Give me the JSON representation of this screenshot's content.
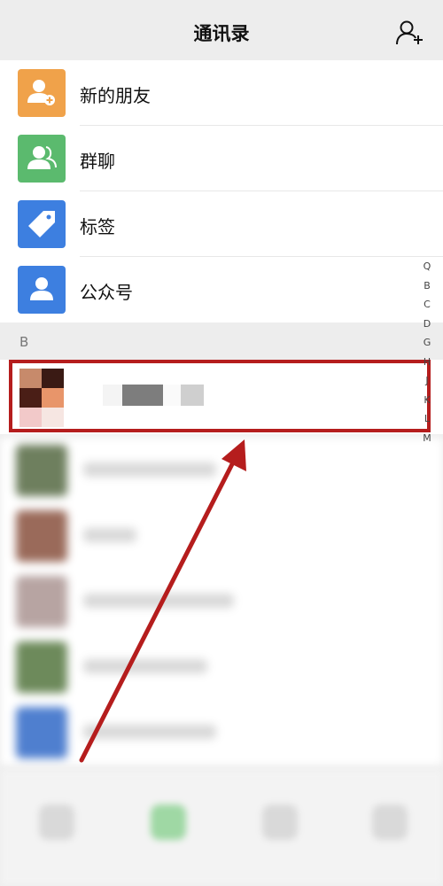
{
  "header": {
    "title": "通讯录",
    "add_icon": "add-contact-icon"
  },
  "menu_items": [
    {
      "label": "新的朋友",
      "icon": "new-friend-icon",
      "color": "#f0a24a"
    },
    {
      "label": "群聊",
      "icon": "group-chat-icon",
      "color": "#5bba6e"
    },
    {
      "label": "标签",
      "icon": "tag-icon",
      "color": "#3d7fe0"
    },
    {
      "label": "公众号",
      "icon": "official-account-icon",
      "color": "#3d7fe0"
    }
  ],
  "section": {
    "letter": "B"
  },
  "index_letters": [
    "Q",
    "B",
    "C",
    "D",
    "G",
    "H",
    "J",
    "K",
    "L",
    "M"
  ],
  "highlight": {
    "color": "#b51d1d"
  }
}
